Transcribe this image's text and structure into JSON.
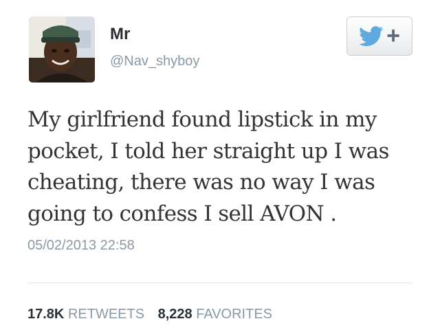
{
  "user": {
    "display_name": "Mr",
    "username": "@Nav_shyboy",
    "avatar_icon": "profile-photo"
  },
  "follow_button": {
    "bird_icon": "twitter-bird-icon",
    "plus_label": "+",
    "bird_color": "#5ea9dd"
  },
  "tweet": {
    "lines": [
      "My girlfriend found lipstick in my",
      "pocket, I told her straight up I was",
      "cheating, there was no way I was",
      "going to confess I sell AVON ."
    ],
    "timestamp": "05/02/2013 22:58"
  },
  "stats": {
    "retweets_count": "17.8K",
    "retweets_label": "RETWEETS",
    "favorites_count": "8,228",
    "favorites_label": "FAVORITES"
  },
  "colors": {
    "text_primary": "#333333",
    "text_secondary": "#8899a6",
    "divider": "#e1e8ed"
  }
}
